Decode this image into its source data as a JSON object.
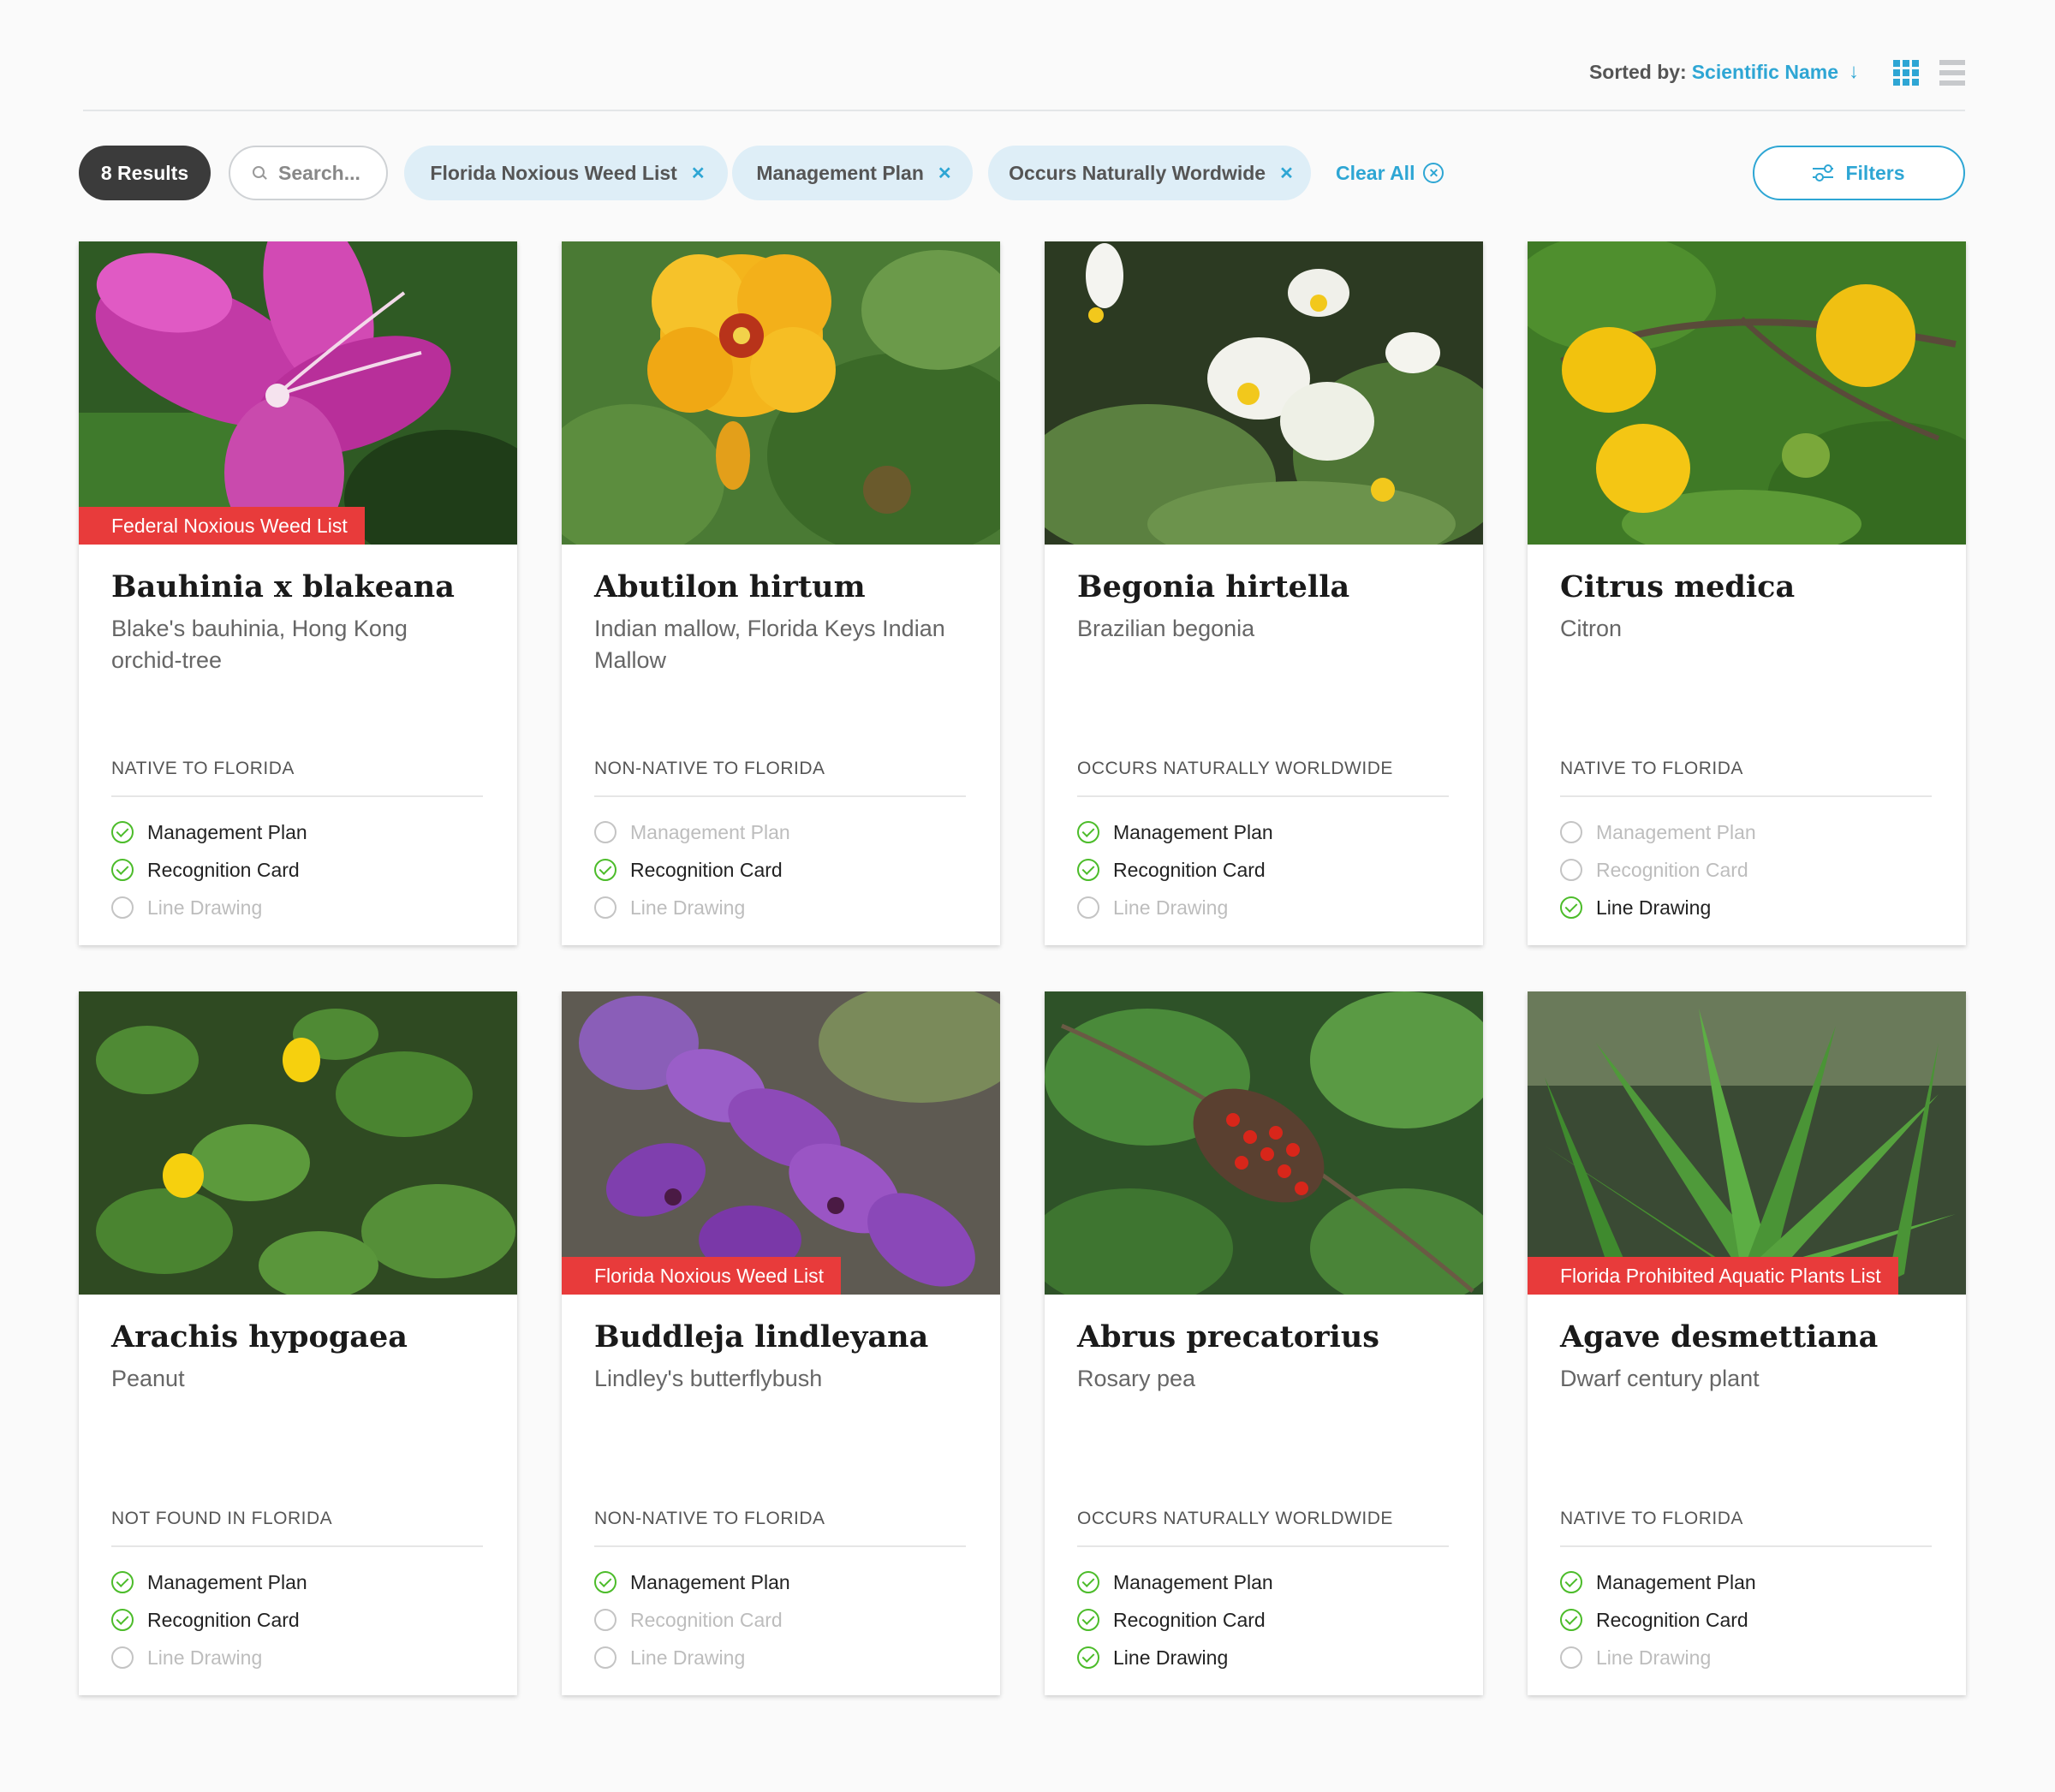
{
  "toolbar": {
    "sorted_label": "Sorted by:",
    "sorted_value": "Scientific Name",
    "grid_view_icon": "grid-view-icon",
    "list_view_icon": "list-view-icon"
  },
  "filterbar": {
    "results": "8 Results",
    "search_placeholder": "Search...",
    "chips": [
      "Florida Noxious Weed List",
      "Management Plan",
      "Occurs Naturally Wordwide"
    ],
    "clear_all": "Clear All",
    "filters": "Filters"
  },
  "colors": {
    "accent": "#2ea6d4",
    "chip_bg": "#deeef7",
    "badge_red": "#e83b3b",
    "check_green": "#4cbc2a",
    "results_pill": "#3b3b3b"
  },
  "feature_labels": [
    "Management Plan",
    "Recognition Card",
    "Line Drawing"
  ],
  "cards": [
    {
      "name": "Bauhinia x blakeana",
      "common": "Blake's bauhinia, Hong Kong orchid-tree",
      "status": "NATIVE TO FLORIDA",
      "badge": "Federal Noxious Weed List",
      "features": [
        true,
        true,
        false
      ],
      "image": "pink-orchid-flower"
    },
    {
      "name": "Abutilon hirtum",
      "common": "Indian mallow, Florida Keys Indian Mallow",
      "status": "NON-NATIVE TO FLORIDA",
      "badge": "",
      "features": [
        false,
        true,
        false
      ],
      "image": "yellow-mallow-flower"
    },
    {
      "name": "Begonia hirtella",
      "common": "Brazilian begonia",
      "status": "OCCURS NATURALLY WORLDWIDE",
      "badge": "",
      "features": [
        true,
        true,
        false
      ],
      "image": "white-begonia-flowers"
    },
    {
      "name": "Citrus medica",
      "common": "Citron",
      "status": "NATIVE TO FLORIDA",
      "badge": "",
      "features": [
        false,
        false,
        true
      ],
      "image": "yellow-citron-fruits"
    },
    {
      "name": "Arachis hypogaea",
      "common": "Peanut",
      "status": "NOT FOUND IN FLORIDA",
      "badge": "",
      "features": [
        true,
        true,
        false
      ],
      "image": "peanut-plant-yellow-flowers"
    },
    {
      "name": "Buddleja lindleyana",
      "common": "Lindley's butterflybush",
      "status": "NON-NATIVE TO FLORIDA",
      "badge": "Florida Noxious Weed List",
      "features": [
        true,
        false,
        false
      ],
      "image": "purple-butterflybush-flowers"
    },
    {
      "name": "Abrus precatorius",
      "common": "Rosary pea",
      "status": "OCCURS NATURALLY WORLDWIDE",
      "badge": "",
      "features": [
        true,
        true,
        true
      ],
      "image": "rosary-pea-red-seeds"
    },
    {
      "name": "Agave desmettiana",
      "common": "Dwarf century plant",
      "status": "NATIVE TO FLORIDA",
      "badge": "Florida Prohibited Aquatic Plants List",
      "features": [
        true,
        true,
        false
      ],
      "image": "agave-plant"
    }
  ]
}
